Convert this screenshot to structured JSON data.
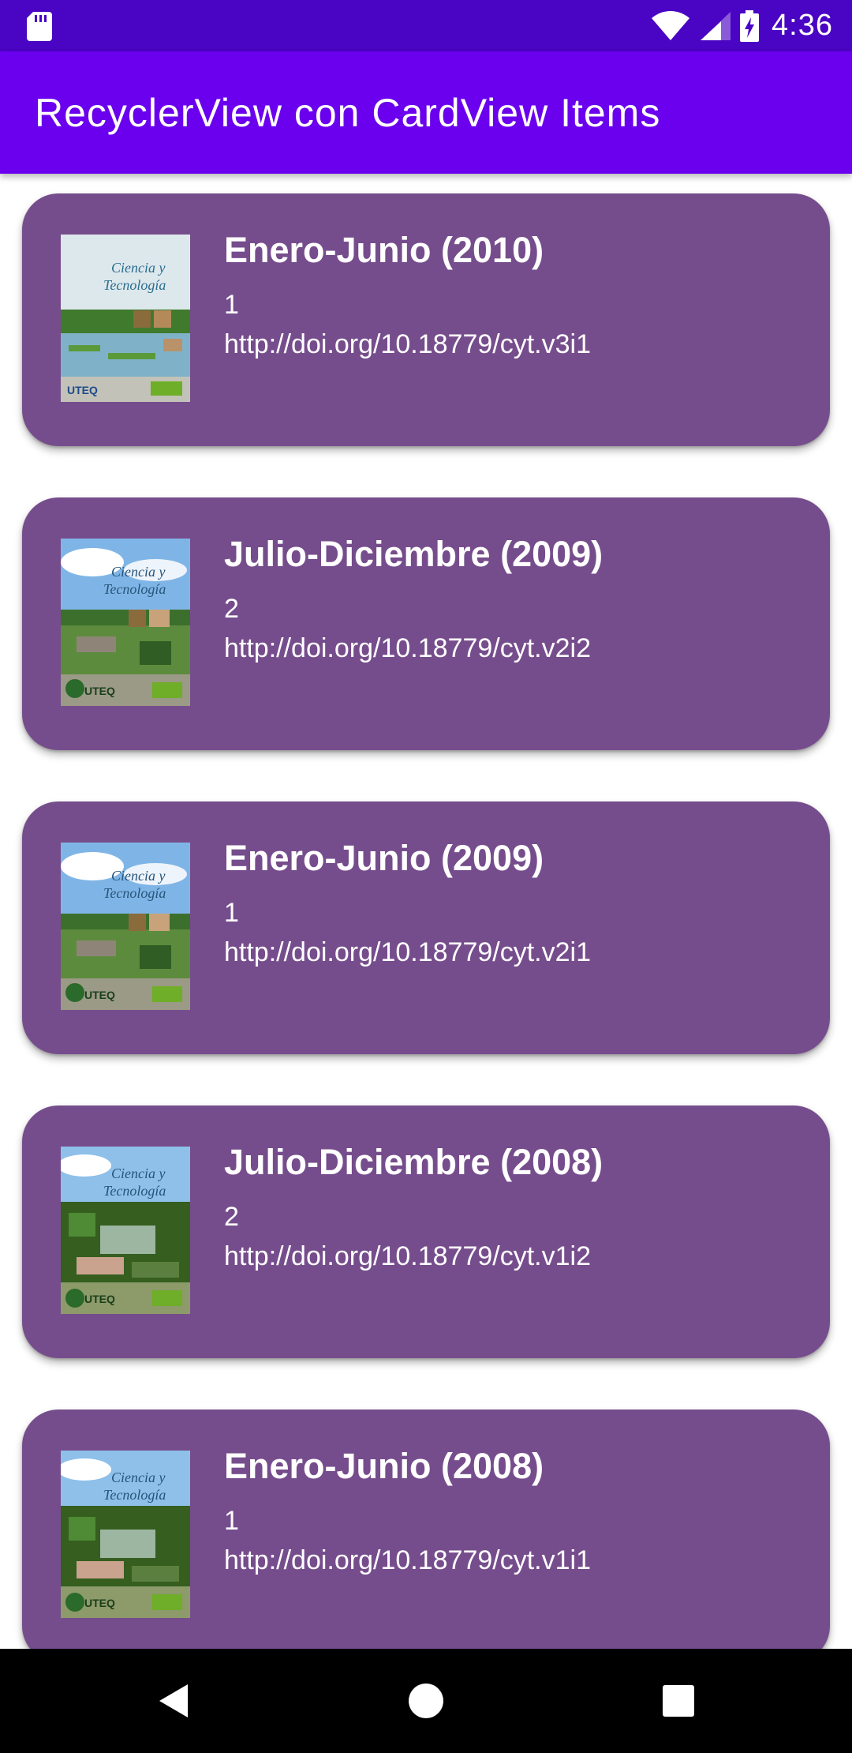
{
  "status_bar": {
    "time": "4:36",
    "icons": [
      "sd-card-icon",
      "wifi-icon",
      "cellular-signal-icon",
      "battery-charging-icon"
    ]
  },
  "app_bar": {
    "title": "RecyclerView con CardView Items"
  },
  "colors": {
    "status_bar": "#4a04c3",
    "app_bar": "#6a00ee",
    "card": "#764d8c",
    "nav_bar": "#000000"
  },
  "cards": [
    {
      "title": "Enero-Junio (2010)",
      "number": "1",
      "doi": "http://doi.org/10.18779/cyt.v3i1",
      "cover_variant": "rice-field"
    },
    {
      "title": "Julio-Diciembre (2009)",
      "number": "2",
      "doi": "http://doi.org/10.18779/cyt.v2i2",
      "cover_variant": "farm"
    },
    {
      "title": "Enero-Junio (2009)",
      "number": "1",
      "doi": "http://doi.org/10.18779/cyt.v2i1",
      "cover_variant": "farm"
    },
    {
      "title": "Julio-Diciembre (2008)",
      "number": "2",
      "doi": "http://doi.org/10.18779/cyt.v1i2",
      "cover_variant": "forest"
    },
    {
      "title": "Enero-Junio (2008)",
      "number": "1",
      "doi": "http://doi.org/10.18779/cyt.v1i1",
      "cover_variant": "forest"
    }
  ],
  "cover_text": {
    "line1": "Ciencia y",
    "line2": "Tecnología",
    "publisher": "UTEQ"
  },
  "nav_bar": {
    "buttons": [
      "back-icon",
      "home-icon",
      "recents-icon"
    ]
  }
}
